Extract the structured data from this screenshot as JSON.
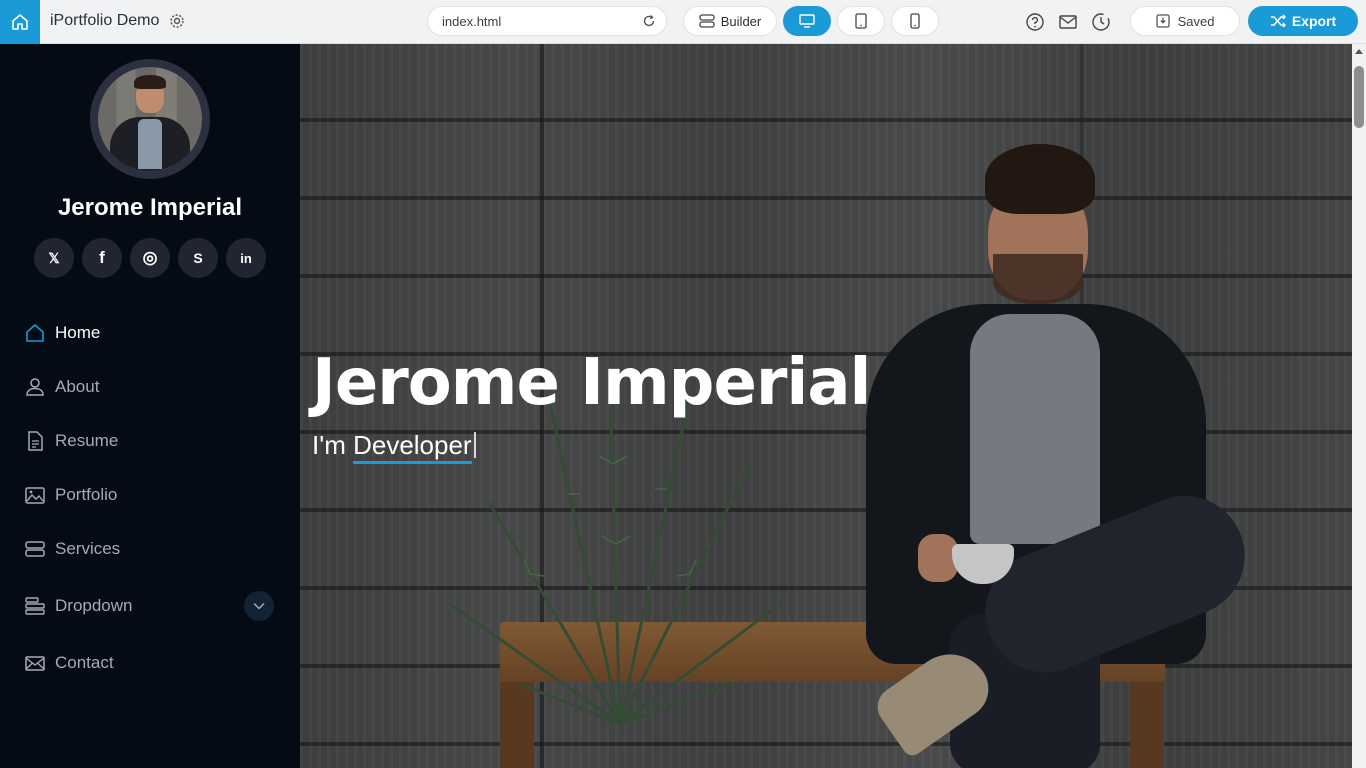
{
  "topbar": {
    "app_title": "iPortfolio Demo",
    "url": "index.html",
    "builder_label": "Builder",
    "saved_label": "Saved",
    "export_label": "Export",
    "accent_color": "#1a9ad6",
    "icons": [
      "home-icon",
      "gear-icon",
      "reload-icon",
      "builder-icon",
      "desktop-icon",
      "tablet-icon",
      "mobile-icon",
      "help-icon",
      "mail-icon",
      "history-icon",
      "save-icon",
      "shuffle-icon"
    ]
  },
  "sidebar": {
    "profile_name": "Jerome Imperial",
    "socials": [
      {
        "name": "x-icon",
        "glyph": "𝕏"
      },
      {
        "name": "facebook-icon",
        "glyph": "f"
      },
      {
        "name": "instagram-icon",
        "glyph": "◎"
      },
      {
        "name": "skype-icon",
        "glyph": "S"
      },
      {
        "name": "linkedin-icon",
        "glyph": "in"
      }
    ],
    "nav": [
      {
        "label": "Home",
        "icon": "house-icon",
        "active": true
      },
      {
        "label": "About",
        "icon": "person-icon"
      },
      {
        "label": "Resume",
        "icon": "file-icon"
      },
      {
        "label": "Portfolio",
        "icon": "images-icon"
      },
      {
        "label": "Services",
        "icon": "server-icon"
      },
      {
        "label": "Dropdown",
        "icon": "menu-icon"
      },
      {
        "label": "Contact",
        "icon": "envelope-icon"
      }
    ]
  },
  "hero": {
    "name": "Jerome Imperial",
    "prefix": "I'm ",
    "typed": "Developer"
  }
}
